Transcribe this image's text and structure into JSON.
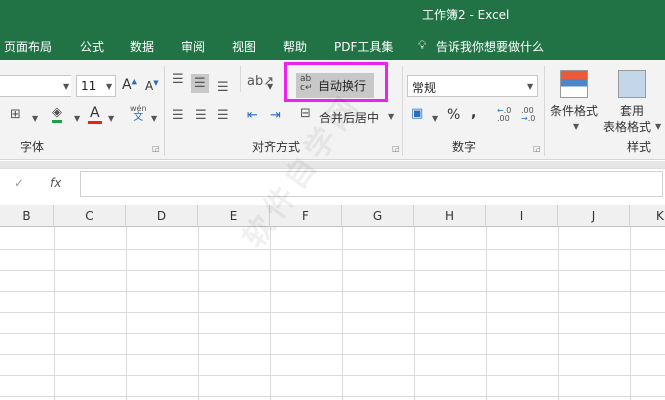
{
  "window": {
    "title": "工作簿2  -  Excel"
  },
  "tabs": [
    "页面布局",
    "公式",
    "数据",
    "审阅",
    "视图",
    "帮助",
    "PDF工具集"
  ],
  "tell_me": "告诉我你想要做什么",
  "font": {
    "size": "11",
    "group_label": "字体"
  },
  "alignment": {
    "wrap_text": "自动换行",
    "merge_center": "合并后居中",
    "group_label": "对齐方式"
  },
  "number": {
    "format": "常规",
    "percent": "%",
    "comma": ",",
    "group_label": "数字"
  },
  "styles": {
    "conditional": "条件格式",
    "table_line1": "套用",
    "table_line2": "表格格式",
    "group_label": "样式"
  },
  "formula_bar": {
    "fx": "fx",
    "cancel": "✓",
    "value": ""
  },
  "columns": [
    "B",
    "C",
    "D",
    "E",
    "F",
    "G",
    "H",
    "I",
    "J",
    "K"
  ],
  "watermark": "软件自学网"
}
